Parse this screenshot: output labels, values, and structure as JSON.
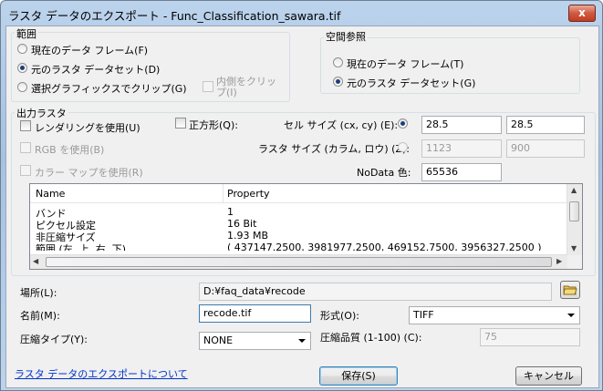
{
  "window": {
    "title": "ラスタ データのエクスポート - Func_Classification_sawara.tif",
    "close_label": "x"
  },
  "extent": {
    "label": "範囲",
    "options": [
      {
        "label": "現在のデータ フレーム(F)",
        "selected": false
      },
      {
        "label": "元のラスタ データセット(D)",
        "selected": true
      },
      {
        "label": "選択グラフィックスでクリップ(G)",
        "selected": false
      }
    ],
    "clip_inside_label": "内側をクリップ(I)"
  },
  "spatial_ref": {
    "label": "空間参照",
    "options": [
      {
        "label": "現在のデータ フレーム(T)",
        "selected": false
      },
      {
        "label": "元のラスタ データセット(G)",
        "selected": true
      }
    ]
  },
  "output": {
    "label": "出力ラスタ",
    "use_renderer_label": "レンダリングを使用(U)",
    "square_label": "正方形(Q):",
    "use_rgb_label": "RGB を使用(B)",
    "use_colormap_label": "カラー マップを使用(R)",
    "cell_size_label": "セル サイズ (cx, cy) (E):",
    "cell_size_x": "28.5",
    "cell_size_y": "28.5",
    "raster_size_label": "ラスタ サイズ (カラム, ロウ) (Z):",
    "raster_cols": "1123",
    "raster_rows": "900",
    "nodata_label": "NoData 色:",
    "nodata_value": "65536"
  },
  "properties_table": {
    "headers": [
      "Name",
      "Property"
    ],
    "rows": [
      [
        "バンド",
        "1"
      ],
      [
        "ピクセル設定",
        "16 Bit"
      ],
      [
        "非圧縮サイズ",
        "1.93 MB"
      ],
      [
        "範囲 (左, 上, 右, 下)",
        "( 437147.2500, 3981977.2500, 469152.7500, 3956327.2500 )"
      ]
    ]
  },
  "location": {
    "label": "場所(L):",
    "value": "D:¥faq_data¥recode"
  },
  "name": {
    "label": "名前(M):",
    "value": "recode.tif"
  },
  "format": {
    "label": "形式(O):",
    "value": "TIFF"
  },
  "compression_type": {
    "label": "圧縮タイプ(Y):",
    "value": "NONE"
  },
  "compression_quality": {
    "label": "圧縮品質 (1-100) (C):",
    "value": "75"
  },
  "footer": {
    "help_link": "ラスタ データのエクスポートについて",
    "save_label": "保存(S)",
    "cancel_label": "キャンセル"
  }
}
